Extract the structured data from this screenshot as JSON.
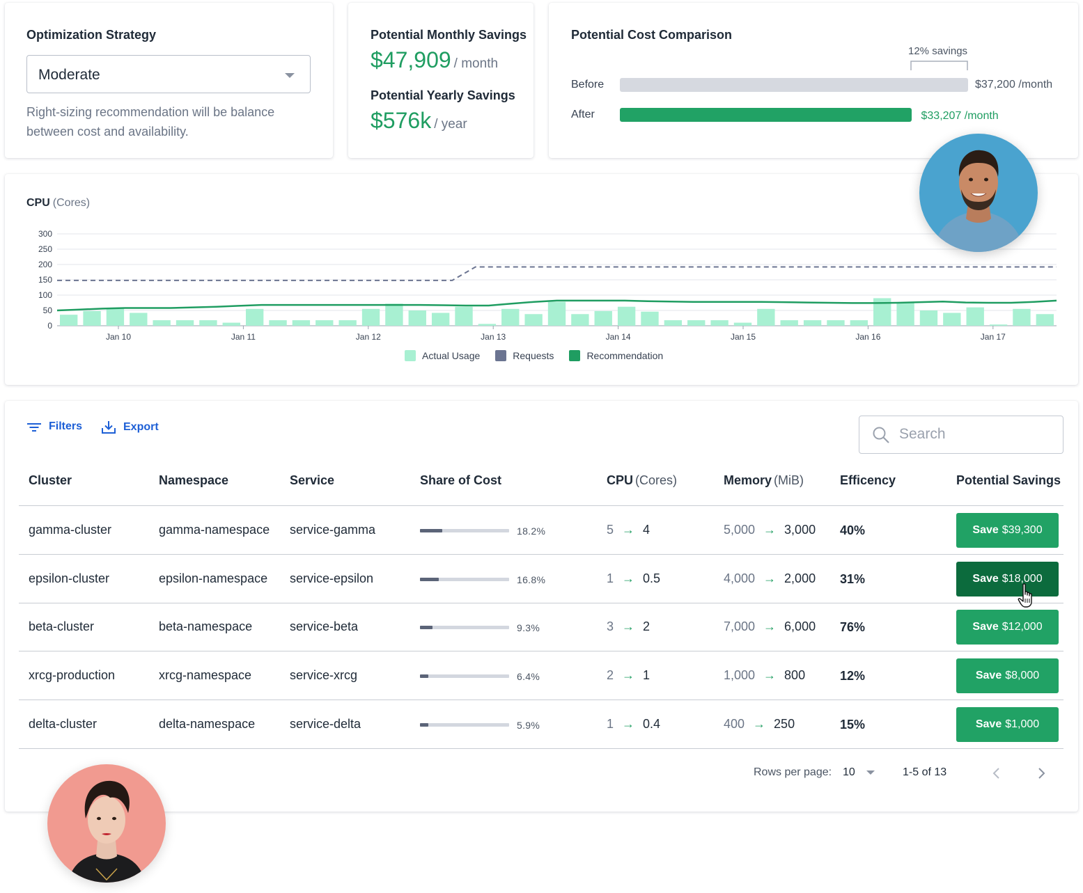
{
  "strategy": {
    "title": "Optimization Strategy",
    "selected": "Moderate",
    "description": "Right-sizing recommendation will be balance between cost and availability."
  },
  "savings": {
    "monthly_title": "Potential Monthly Savings",
    "monthly_value": "$47,909",
    "monthly_unit": "/ month",
    "yearly_title": "Potential Yearly Savings",
    "yearly_value": "$576k",
    "yearly_unit": "/ year"
  },
  "comparison": {
    "title": "Potential Cost Comparison",
    "savings_label": "12% savings",
    "before_label": "Before",
    "before_value": "$37,200 /month",
    "after_label": "After",
    "after_value": "$33,207 /month",
    "after_fraction": 0.837
  },
  "colors": {
    "accent_green": "#1f9d61",
    "actual_usage": "#a8f0d2",
    "requests": "#6b7491",
    "recommendation": "#1f9d61",
    "link_blue": "#1d5fd6",
    "button_green": "#21a265",
    "button_green_active": "#0c6b3d"
  },
  "cpu_chart": {
    "title": "CPU",
    "unit": "(Cores)"
  },
  "chart_data": {
    "type": "bar",
    "x_ticks": [
      "Jan 10",
      "Jan 11",
      "Jan 12",
      "Jan 13",
      "Jan 14",
      "Jan 15",
      "Jan 16",
      "Jan 17"
    ],
    "y_ticks": [
      0,
      50,
      100,
      150,
      200,
      250,
      300
    ],
    "ylim": [
      0,
      300
    ],
    "grid": true,
    "legend_position": "bottom",
    "series": [
      {
        "name": "Actual Usage",
        "kind": "bar",
        "values": [
          36,
          48,
          58,
          42,
          18,
          18,
          18,
          10,
          55,
          18,
          18,
          18,
          18,
          55,
          72,
          50,
          42,
          62,
          6,
          55,
          38,
          78,
          38,
          48,
          62,
          46,
          18,
          18,
          18,
          10,
          55,
          18,
          18,
          18,
          18,
          90,
          74,
          50,
          42,
          60,
          4,
          55,
          38
        ]
      },
      {
        "name": "Requests",
        "kind": "dashed-line",
        "values": [
          148,
          148,
          148,
          148,
          148,
          148,
          148,
          148,
          148,
          148,
          148,
          148,
          148,
          148,
          148,
          148,
          148,
          148,
          192,
          192,
          192,
          192,
          192,
          192,
          192,
          192,
          192,
          192,
          192,
          192,
          192,
          192,
          192,
          192,
          192,
          192,
          192,
          192,
          192,
          192,
          192,
          192,
          192,
          192
        ]
      },
      {
        "name": "Recommendation",
        "kind": "line",
        "values": [
          50,
          53,
          56,
          58,
          58,
          58,
          60,
          62,
          65,
          68,
          68,
          68,
          68,
          68,
          68,
          68,
          68,
          67,
          66,
          66,
          72,
          78,
          82,
          82,
          82,
          82,
          80,
          79,
          78,
          78,
          78,
          78,
          77,
          76,
          75,
          74,
          74,
          75,
          77,
          79,
          76,
          75,
          75,
          78,
          82
        ]
      }
    ]
  },
  "toolbar": {
    "filters_label": "Filters",
    "export_label": "Export",
    "search_placeholder": "Search"
  },
  "table": {
    "columns": [
      {
        "label": "Cluster",
        "unit": ""
      },
      {
        "label": "Namespace",
        "unit": ""
      },
      {
        "label": "Service",
        "unit": ""
      },
      {
        "label": "Share of Cost",
        "unit": ""
      },
      {
        "label": "CPU",
        "unit": "(Cores)"
      },
      {
        "label": "Memory",
        "unit": "(MiB)"
      },
      {
        "label": "Efficency",
        "unit": ""
      },
      {
        "label": "Potential Savings",
        "unit": ""
      }
    ],
    "rows": [
      {
        "cluster": "gamma-cluster",
        "namespace": "gamma-namespace",
        "service": "service-gamma",
        "share": "18.2%",
        "share_fraction": 0.25,
        "cpu_from": "5",
        "cpu_to": "4",
        "mem_from": "5,000",
        "mem_to": "3,000",
        "efficiency": "40%",
        "save_prefix": "Save",
        "save_amount": "$39,300",
        "active": false
      },
      {
        "cluster": "epsilon-cluster",
        "namespace": "epsilon-namespace",
        "service": "service-epsilon",
        "share": "16.8%",
        "share_fraction": 0.21,
        "cpu_from": "1",
        "cpu_to": "0.5",
        "mem_from": "4,000",
        "mem_to": "2,000",
        "efficiency": "31%",
        "save_prefix": "Save",
        "save_amount": "$18,000",
        "active": true
      },
      {
        "cluster": "beta-cluster",
        "namespace": "beta-namespace",
        "service": "service-beta",
        "share": "9.3%",
        "share_fraction": 0.14,
        "cpu_from": "3",
        "cpu_to": "2",
        "mem_from": "7,000",
        "mem_to": "6,000",
        "efficiency": "76%",
        "save_prefix": "Save",
        "save_amount": "$12,000",
        "active": false
      },
      {
        "cluster": "xrcg-production",
        "namespace": "xrcg-namespace",
        "service": "service-xrcg",
        "share": "6.4%",
        "share_fraction": 0.09,
        "cpu_from": "2",
        "cpu_to": "1",
        "mem_from": "1,000",
        "mem_to": "800",
        "efficiency": "12%",
        "save_prefix": "Save",
        "save_amount": "$8,000",
        "active": false
      },
      {
        "cluster": "delta-cluster",
        "namespace": "delta-namespace",
        "service": "service-delta",
        "share": "5.9%",
        "share_fraction": 0.09,
        "cpu_from": "1",
        "cpu_to": "0.4",
        "mem_from": "400",
        "mem_to": "250",
        "efficiency": "15%",
        "save_prefix": "Save",
        "save_amount": "$1,000",
        "active": false
      }
    ]
  },
  "pagination": {
    "rows_per_page_label": "Rows per page:",
    "rows_per_page_value": "10",
    "range": "1-5 of 13"
  }
}
